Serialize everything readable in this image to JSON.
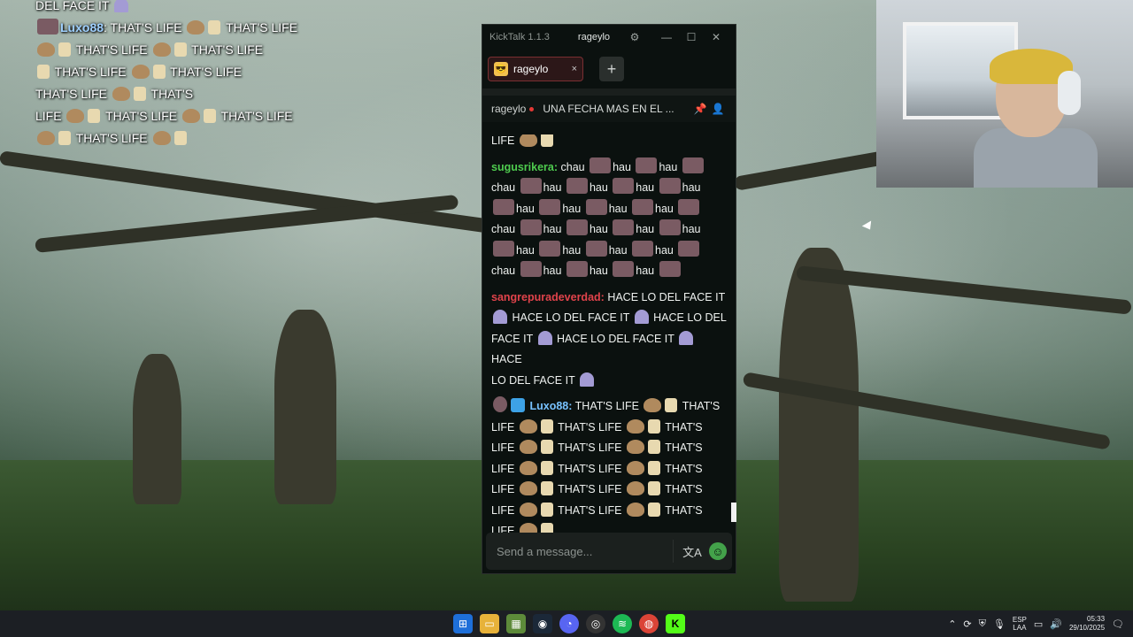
{
  "overlay": {
    "top_text": "DEL FACE IT",
    "user": "Luxo88",
    "line": "THAT'S LIFE",
    "lines": [
      "THAT'S LIFE",
      "THAT'S LIFE",
      "THAT'S LIFE",
      "THAT'S LIFE",
      "THAT'S LIFE",
      "THAT'S LIFE",
      "THAT'S LIFE",
      "THAT'S",
      "LIFE",
      "THAT'S LIFE",
      "THAT'S LIFE",
      "THAT'S LIFE"
    ]
  },
  "window": {
    "app_name": "KickTalk 1.1.3",
    "channel_pill": "rageylo",
    "settings_icon": "gear-icon",
    "minimize_icon": "minimize-icon",
    "maximize_icon": "maximize-icon",
    "close_icon": "close-icon"
  },
  "tabs": [
    {
      "label": "rageylo",
      "close": "×"
    }
  ],
  "add_tab": "+",
  "channel_bar": {
    "name": "rageylo",
    "title": "UNA FECHA MAS EN EL ...",
    "pin_icon": "pin-icon",
    "user_icon": "user-icon"
  },
  "messages": [
    {
      "user": "",
      "text": "LIFE"
    },
    {
      "user": "sugusrikera:",
      "color": "#4ecb4e",
      "text": "chau",
      "emote_text": "chau",
      "emote_label": "hau"
    },
    {
      "user": "sangrepuradeverdad:",
      "color": "#e0434b",
      "text": "HACE LO DEL FACE IT",
      "segments": [
        "HACE LO DEL FACE IT",
        "HACE LO DEL",
        "FACE IT",
        "HACE LO DEL FACE IT",
        "HACE",
        "LO DEL FACE IT"
      ]
    },
    {
      "user": "Luxo88:",
      "color": "#78c2ff",
      "text": "THAT'S LIFE",
      "segments": [
        "THAT'S LIFE",
        "THAT'S",
        "LIFE",
        "THAT'S LIFE",
        "THAT'S",
        "LIFE",
        "THAT'S LIFE",
        "THAT'S",
        "LIFE",
        "THAT'S LIFE",
        "THAT'S",
        "LIFE",
        "THAT'S LIFE",
        "THAT'S",
        "LIFE",
        "THAT'S LIFE",
        "THAT'S",
        "LIFE"
      ]
    }
  ],
  "input": {
    "placeholder": "Send a message...",
    "translate_icon": "translate-icon",
    "emote_icon": "emote-icon"
  },
  "taskbar": {
    "apps": [
      "windows-start-icon",
      "file-explorer-icon",
      "minecraft-icon",
      "steam-icon",
      "discord-icon",
      "obs-icon",
      "spotify-icon",
      "chrome-icon",
      "kick-icon"
    ],
    "lang_top": "ESP",
    "lang_bottom": "LAA",
    "time": "05:33",
    "date": "29/10/2025"
  }
}
